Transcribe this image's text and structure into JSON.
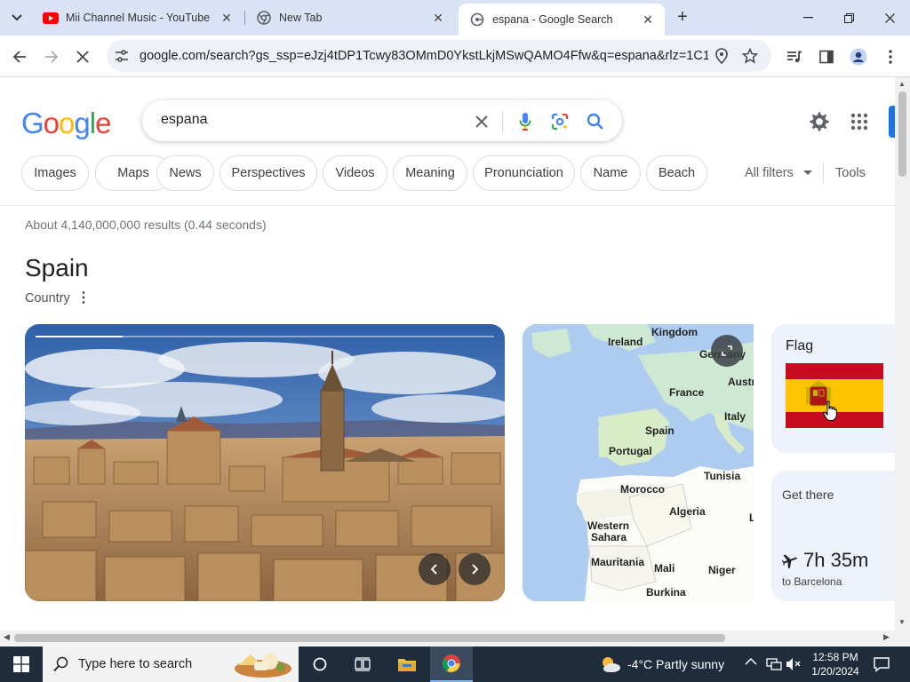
{
  "browser": {
    "tabs": [
      {
        "title": "Mii Channel Music - YouTube",
        "favicon": "youtube-icon",
        "active": false
      },
      {
        "title": "New Tab",
        "favicon": "chrome-icon",
        "active": false
      },
      {
        "title": "espana - Google Search",
        "favicon": "google-icon",
        "active": true
      }
    ],
    "url": "google.com/search?gs_ssp=eJzj4tDP1Tcwy83OMmD0YkstLkjMSwQAMO4Ffw&q=espana&rlz=1C1GC..."
  },
  "search": {
    "query": "espana",
    "logo_text": "Google",
    "chips": [
      "Images",
      "Maps",
      "News",
      "Perspectives",
      "Videos",
      "Meaning",
      "Pronunciation",
      "Name",
      "Beach"
    ],
    "all_filters_label": "All filters",
    "tools_label": "Tools",
    "results_stats": "About 4,140,000,000 results (0.44 seconds)"
  },
  "knowledge_panel": {
    "title": "Spain",
    "subtitle": "Country",
    "map_labels": [
      "Kingdom",
      "Ireland",
      "Germany",
      "France",
      "Austr",
      "Italy",
      "Spain",
      "Portugal",
      "Tunisia",
      "Morocco",
      "Algeria",
      "L",
      "Western",
      "Sahara",
      "Mauritania",
      "Mali",
      "Niger",
      "Burkina"
    ],
    "flag_label": "Flag",
    "get_there_label": "Get there",
    "travel_time": "7h 35m",
    "destination": "to Barcelona"
  },
  "taskbar": {
    "search_placeholder": "Type here to search",
    "weather": "-4°C  Partly sunny",
    "time": "12:58 PM",
    "date": "1/20/2024"
  },
  "colors": {
    "google_blue": "#4285f4",
    "google_red": "#ea4335",
    "google_yellow": "#fbbc05",
    "google_green": "#34a853",
    "flag_red": "#c60b1e",
    "flag_yellow": "#ffc400"
  }
}
